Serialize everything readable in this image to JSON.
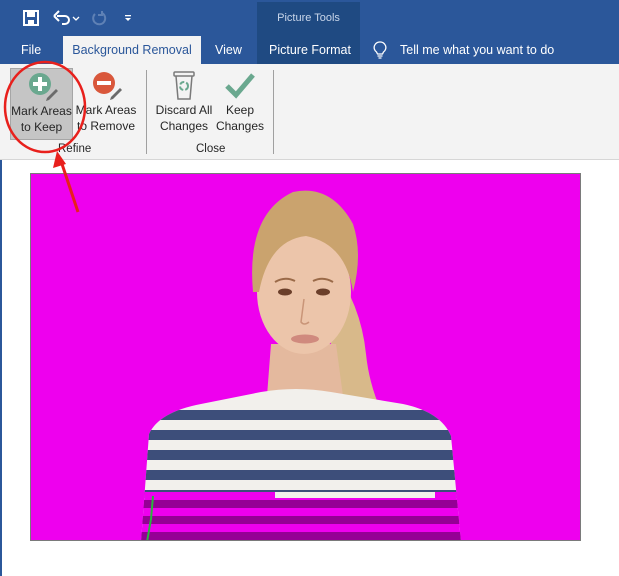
{
  "quick_access": {
    "save_icon": "save-icon",
    "undo_icon": "undo-icon",
    "redo_icon": "redo-icon",
    "customize_icon": "customize-qat-icon"
  },
  "contextual_group": {
    "title": "Picture Tools"
  },
  "tabs": [
    {
      "label": "File",
      "active": false
    },
    {
      "label": "Background Removal",
      "active": true
    },
    {
      "label": "View",
      "active": false
    },
    {
      "label": "Picture Format",
      "active": false
    }
  ],
  "tell_me": {
    "icon": "lightbulb-icon",
    "placeholder": "Tell me what you want to do"
  },
  "ribbon": {
    "groups": [
      {
        "label": "Refine",
        "buttons": [
          {
            "line1": "Mark Areas",
            "line2": "to Keep",
            "icon": "mark-keep-icon",
            "selected": true
          },
          {
            "line1": "Mark Areas",
            "line2": "to Remove",
            "icon": "mark-remove-icon",
            "selected": false
          }
        ]
      },
      {
        "label": "Close",
        "buttons": [
          {
            "line1": "Discard All",
            "line2": "Changes",
            "icon": "recycle-bin-icon",
            "selected": false
          },
          {
            "line1": "Keep",
            "line2": "Changes",
            "icon": "checkmark-icon",
            "selected": false
          }
        ]
      }
    ]
  },
  "colors": {
    "brand": "#2b579a",
    "contextual": "#1f4a82",
    "removal_overlay": "#ee00ee",
    "keep_icon": "#6aa88f",
    "remove_icon": "#d9573b",
    "annotation": "#e8201c"
  },
  "document": {
    "image_description": "Portrait of a blonde woman in a navy and white striped top; magenta background removal overlay"
  }
}
